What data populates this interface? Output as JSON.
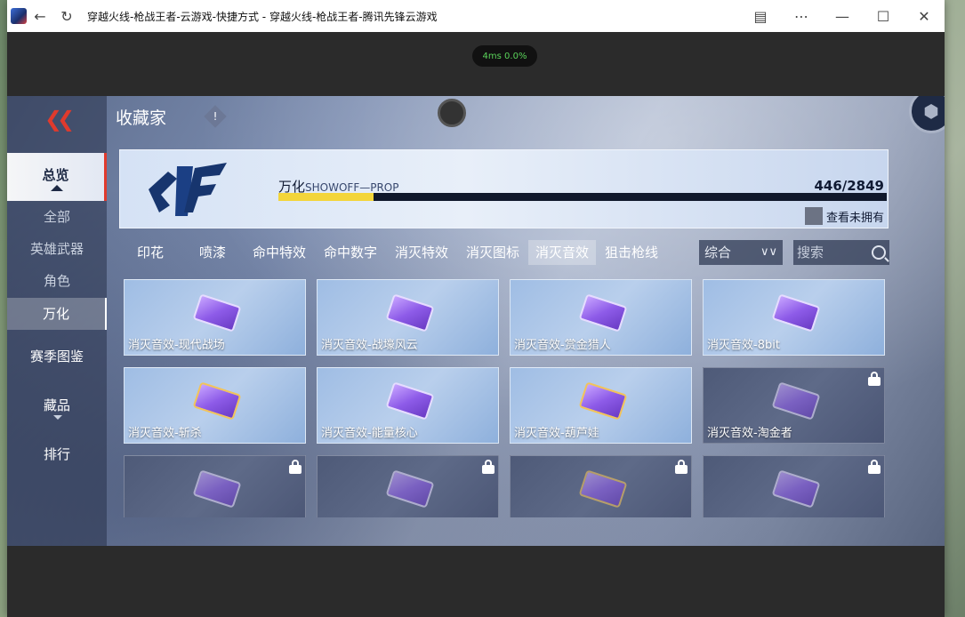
{
  "window": {
    "title": "穿越火线-枪战王者-云游戏-快捷方式 - 穿越火线-枪战王者-腾讯先锋云游戏"
  },
  "overlay": {
    "ping": "4ms 0.0%"
  },
  "header": {
    "title": "收藏家",
    "info": "!"
  },
  "leftnav": {
    "overview": "总览",
    "sub": [
      "全部",
      "英雄武器",
      "角色",
      "万化"
    ],
    "season": "赛季图鉴",
    "collection": "藏品",
    "ranking": "排行"
  },
  "banner": {
    "name": "万化",
    "name_en": "SHOWOFF—PROP",
    "count": "446/2849",
    "progress": 0.157,
    "check_label": "查看未拥有"
  },
  "tabs": [
    "印花",
    "喷漆",
    "命中特效",
    "命中数字",
    "消灭特效",
    "消灭图标",
    "消灭音效",
    "狙击枪线"
  ],
  "active_tab": "消灭音效",
  "sort": {
    "selected": "综合"
  },
  "search": {
    "placeholder": "搜索"
  },
  "cards": [
    {
      "label": "消灭音效-现代战场",
      "locked": false,
      "gold": false
    },
    {
      "label": "消灭音效-战壕风云",
      "locked": false,
      "gold": false
    },
    {
      "label": "消灭音效-赏金猎人",
      "locked": false,
      "gold": false
    },
    {
      "label": "消灭音效-8bit",
      "locked": false,
      "gold": false
    },
    {
      "label": "消灭音效-斩杀",
      "locked": false,
      "gold": true
    },
    {
      "label": "消灭音效-能量核心",
      "locked": false,
      "gold": false
    },
    {
      "label": "消灭音效-葫芦娃",
      "locked": false,
      "gold": true
    },
    {
      "label": "消灭音效-淘金者",
      "locked": true,
      "gold": false
    },
    {
      "label": "",
      "locked": true,
      "gold": false
    },
    {
      "label": "",
      "locked": true,
      "gold": false
    },
    {
      "label": "",
      "locked": true,
      "gold": true
    },
    {
      "label": "",
      "locked": true,
      "gold": false
    }
  ]
}
